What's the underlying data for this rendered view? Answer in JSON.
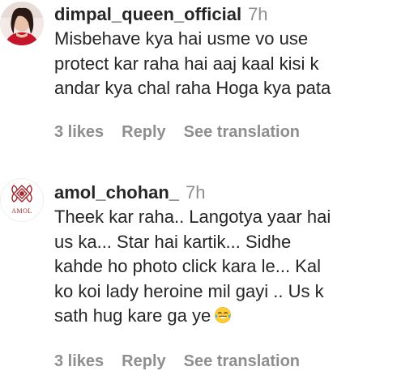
{
  "comments": [
    {
      "username": "dimpal_queen_official",
      "time": "7h",
      "avatar_icon": "profile-photo-woman",
      "lines": [
        "Misbehave kya hai usme vo use",
        "protect kar raha hai aaj kaal kisi k",
        "andar kya chal raha Hoga kya pata"
      ],
      "likes": "3 likes",
      "reply": "Reply",
      "see_translation": "See translation"
    },
    {
      "username": "amol_chohan_",
      "time": "7h",
      "avatar_icon": "amol-logo",
      "avatar_logo_text": "AMOL",
      "lines": [
        "Theek kar raha.. Langotya yaar hai",
        "us ka... Star hai kartik... Sidhe",
        "kahde ho photo click kara le... Kal",
        "ko koi lady heroine mil gayi .. Us k",
        "sath hug kare ga ye"
      ],
      "emoji": "face-with-tears-of-joy-emoji",
      "likes": "3 likes",
      "reply": "Reply",
      "see_translation": "See translation"
    }
  ],
  "colors": {
    "text": "#262626",
    "secondary": "#8e8e8e",
    "logo": "#a0272d"
  }
}
